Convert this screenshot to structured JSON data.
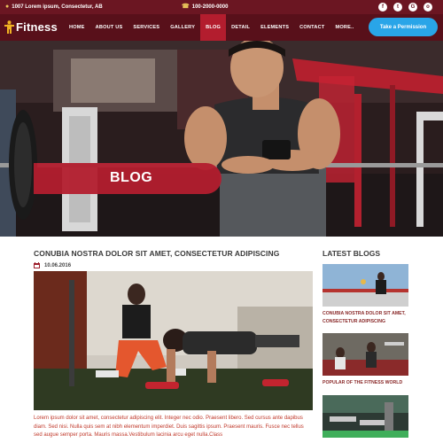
{
  "topbar": {
    "address": "1007 Lorem ipsum, Consectetur, AB",
    "phone": "100-2000-0000",
    "address_icon": "map-pin-icon",
    "phone_icon": "phone-icon",
    "social": [
      {
        "icon": "facebook-icon",
        "glyph": "f"
      },
      {
        "icon": "twitter-icon",
        "glyph": "t"
      },
      {
        "icon": "google-plus-icon",
        "glyph": "G"
      },
      {
        "icon": "instagram-icon",
        "glyph": "o"
      }
    ]
  },
  "nav": {
    "logo": "Fitness",
    "items": [
      "HOME",
      "ABOUT US",
      "SERVICES",
      "GALLERY",
      "BLOG",
      "DETAIL",
      "ELEMENTS",
      "CONTACT",
      "MORE.."
    ],
    "active": "BLOG",
    "cta_label": "Take a Permission"
  },
  "hero": {
    "title": "BLOG"
  },
  "article": {
    "title": "CONUBIA NOSTRA DOLOR SIT AMET, CONSECTETUR ADIPISCING",
    "date": "10.06.2016",
    "body": "Lorem ipsum dolor sit amet, consectetur adipiscing elit. Integer nec odio. Praesent libero. Sed cursus ante dapibus diam. Sed nisi. Nulla quis sem at nibh elementum imperdiet. Duis sagittis ipsum. Praesent mauris. Fusce nec tellus sed augue semper porta. Mauris massa.Vestibulum lacinia arcu eget nulla.Class"
  },
  "sidebar": {
    "title": "LATEST BLOGS",
    "posts": [
      {
        "caption": "CONUBIA NOSTRA DOLOR SIT AMET, CONSECTETUR ADIPISCING"
      },
      {
        "caption": "POPULAR OF THE FITNESS WORLD"
      },
      {
        "caption": ""
      }
    ]
  },
  "colors": {
    "topbar": "#6b1622",
    "navbar": "#58101a",
    "accent": "#b31d2e",
    "cta": "#29a5e8",
    "body_text": "#c0392b"
  }
}
